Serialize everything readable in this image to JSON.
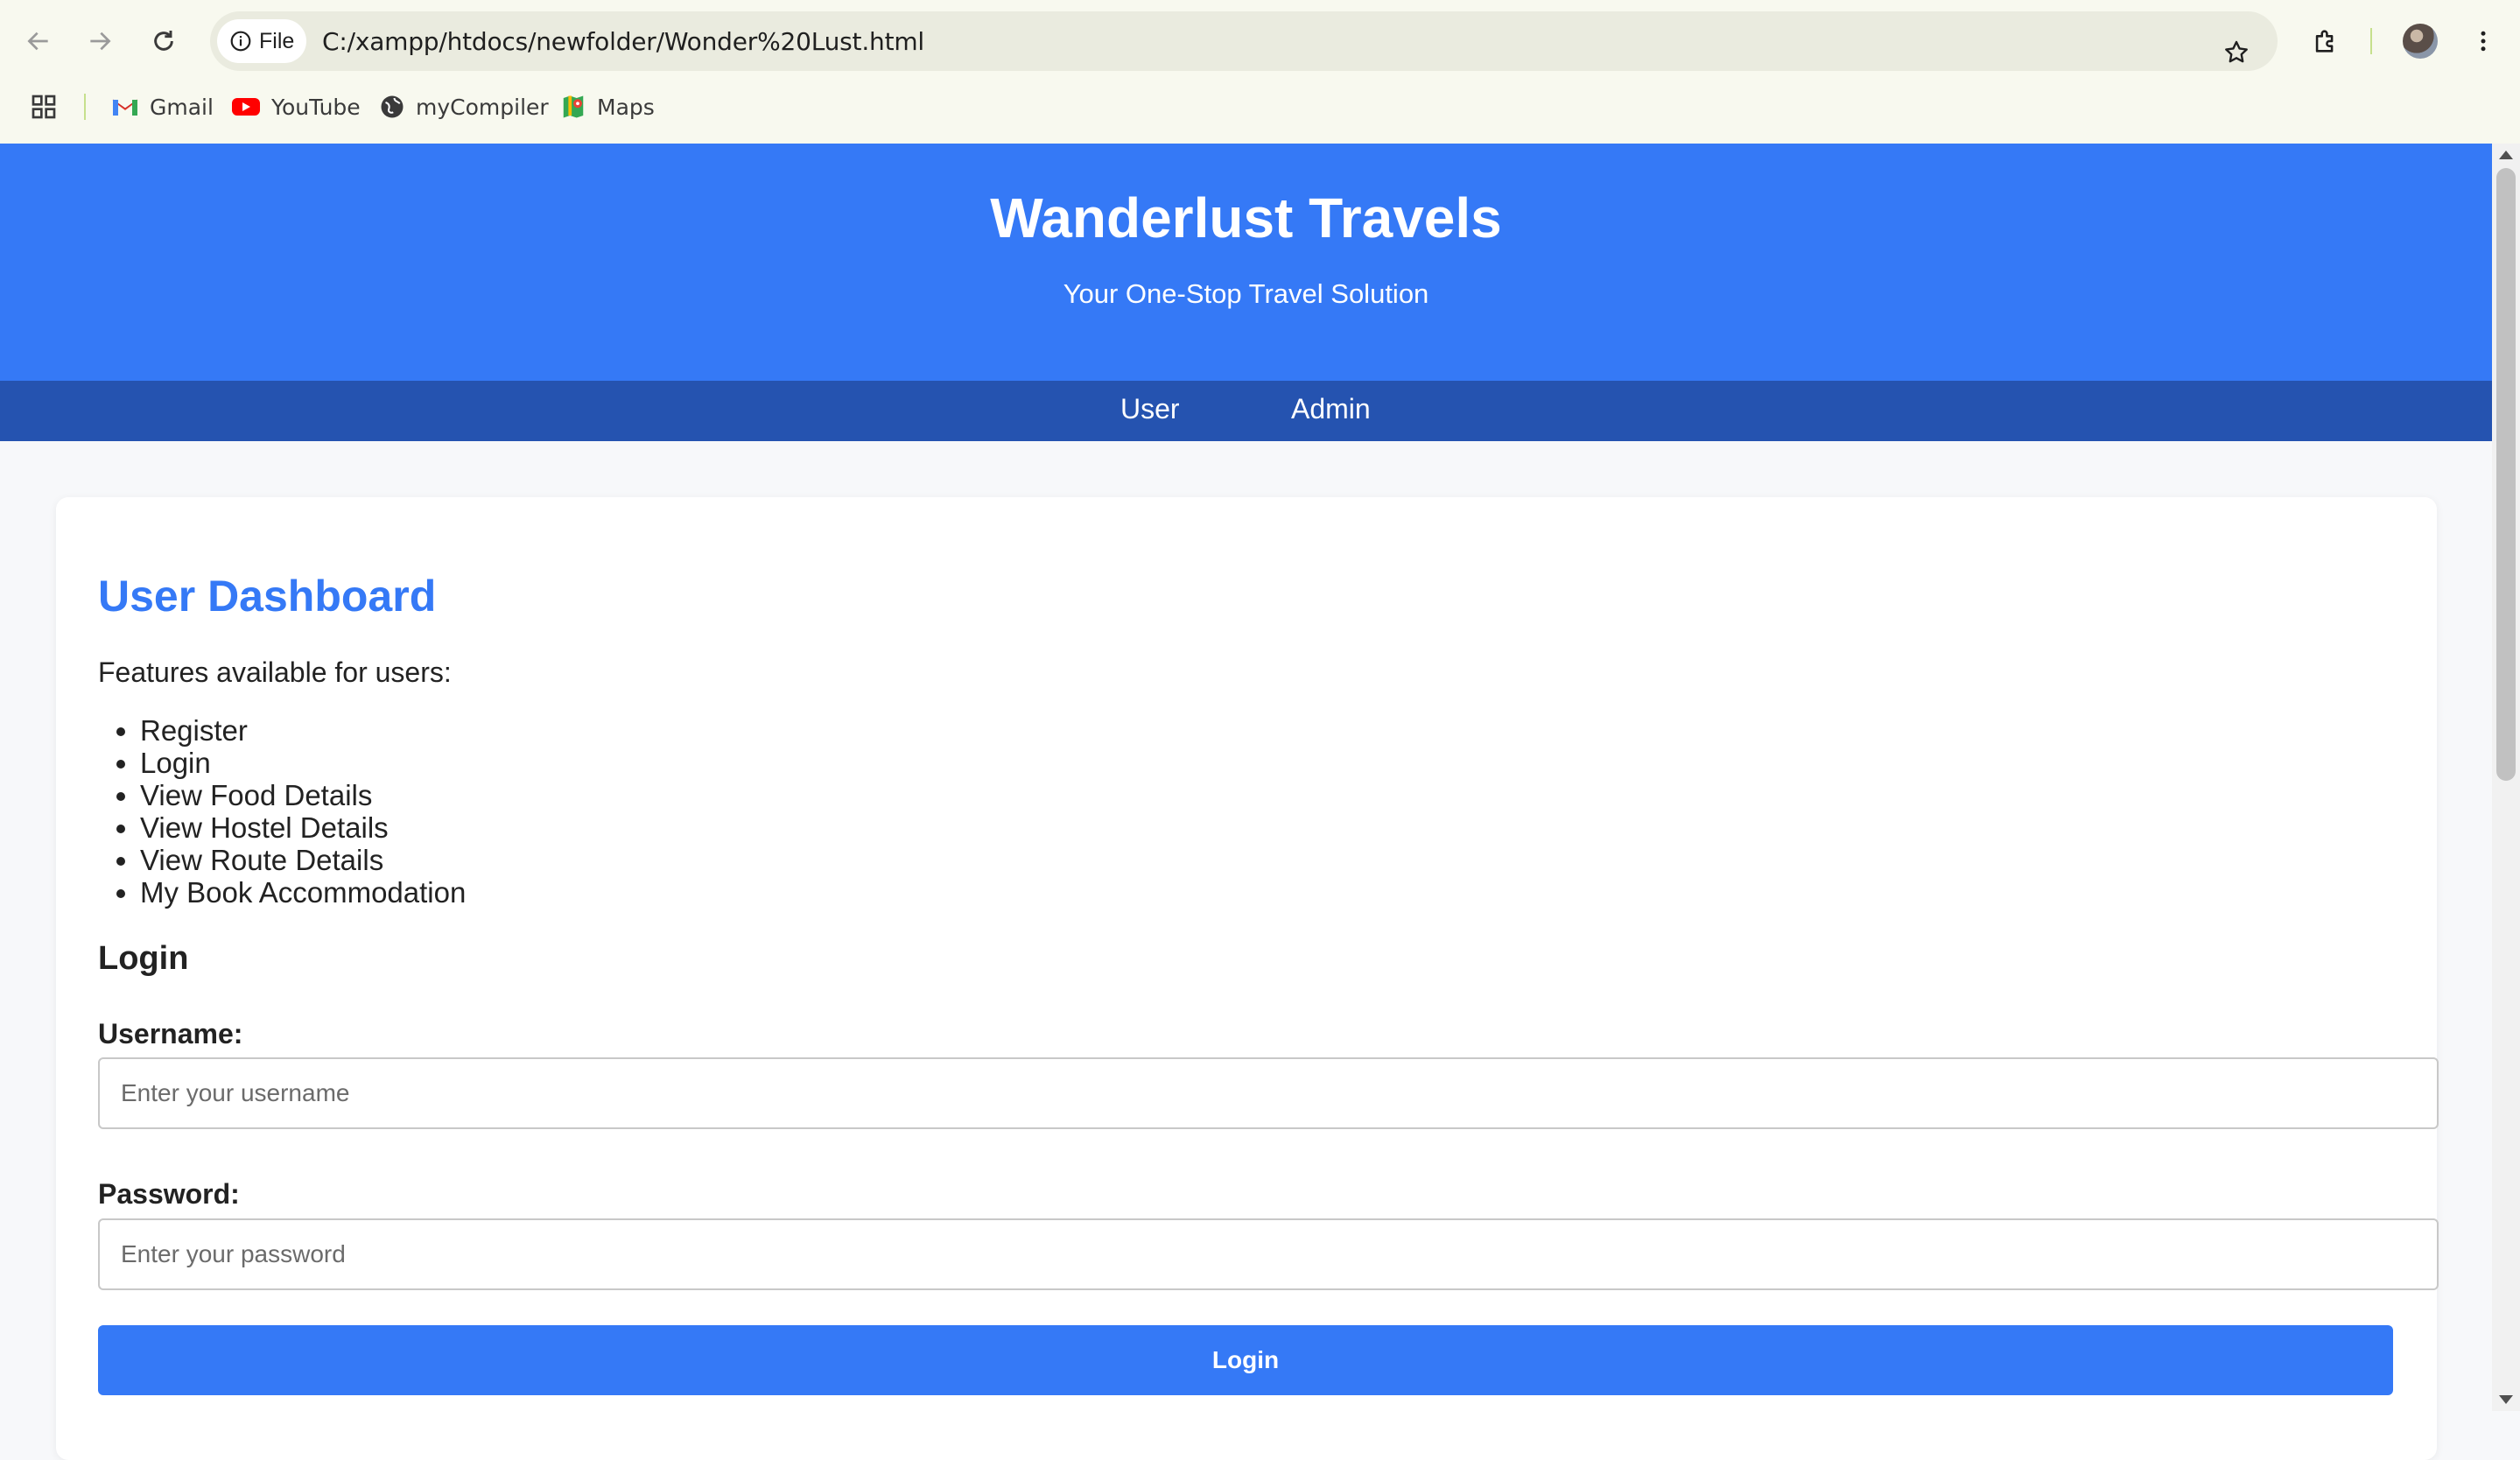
{
  "browser": {
    "file_chip_label": "File",
    "url": "C:/xampp/htdocs/newfolder/Wonder%20Lust.html",
    "bookmarks": [
      "Gmail",
      "YouTube",
      "myCompiler",
      "Maps"
    ]
  },
  "header": {
    "title": "Wanderlust Travels",
    "tagline": "Your One-Stop Travel Solution"
  },
  "nav": [
    "User",
    "Admin"
  ],
  "dashboard": {
    "title": "User Dashboard",
    "intro": "Features available for users:",
    "features": [
      "Register",
      "Login",
      "View Food Details",
      "View Hostel Details",
      "View Route Details",
      "My Book Accommodation"
    ]
  },
  "login": {
    "heading": "Login",
    "username_label": "Username:",
    "username_placeholder": "Enter your username",
    "password_label": "Password:",
    "password_placeholder": "Enter your password",
    "button_label": "Login"
  },
  "colors": {
    "header_blue": "#3579f6",
    "nav_blue": "#2553b0",
    "accent": "#3579f6"
  }
}
